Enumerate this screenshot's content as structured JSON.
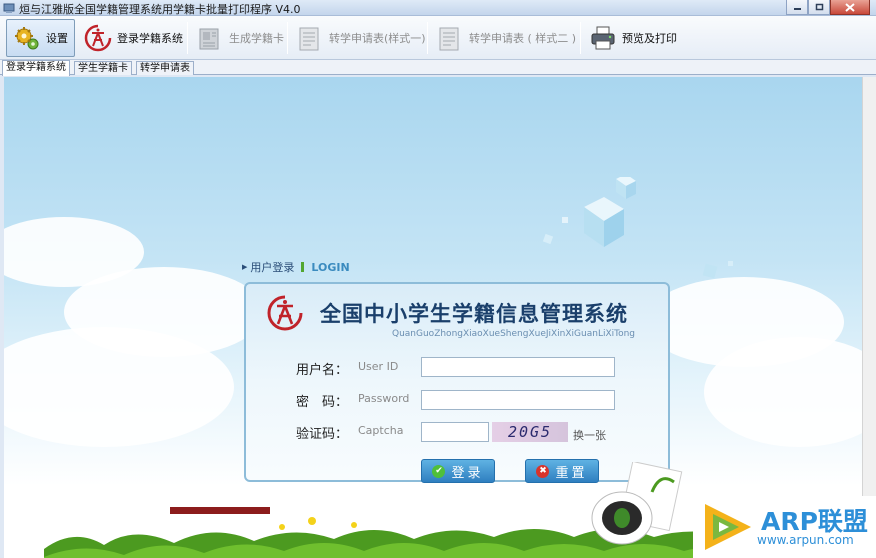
{
  "window": {
    "title": "烜与江雅版全国学籍管理系统用学籍卡批量打印程序 V4.0"
  },
  "toolbar": {
    "items": [
      {
        "label": "设置",
        "icon": "gear-icon",
        "state": "active"
      },
      {
        "label": "登录学籍系统",
        "icon": "system-logo-icon",
        "state": "enabled"
      },
      {
        "label": "生成学籍卡",
        "icon": "card-icon",
        "state": "disabled"
      },
      {
        "label": "转学申请表(样式一)",
        "icon": "form-icon",
        "state": "disabled"
      },
      {
        "label": "转学申请表 ( 样式二 )",
        "icon": "form-icon",
        "state": "disabled"
      },
      {
        "label": "预览及打印",
        "icon": "printer-icon",
        "state": "enabled"
      }
    ]
  },
  "tabs": [
    {
      "label": "登录学籍系统",
      "active": true
    },
    {
      "label": "学生学籍卡",
      "active": false
    },
    {
      "label": "转学申请表",
      "active": false
    }
  ],
  "login": {
    "header_cn": "用户登录",
    "header_en": "LOGIN",
    "system_title": "全国中小学生学籍信息管理系统",
    "system_pinyin": "QuanGuoZhongXiaoXueShengXueJiXinXiGuanLiXiTong",
    "username_label": "用户名：",
    "username_hint": "User ID",
    "username_value": "",
    "password_label": "密　码：",
    "password_hint": "Password",
    "password_value": "",
    "captcha_label": "验证码：",
    "captcha_hint": "Captcha",
    "captcha_value": "",
    "captcha_image_text": "20G5",
    "refresh_label": "换一张",
    "login_button": "登录",
    "reset_button": "重置"
  },
  "watermark": {
    "title": "ARP联盟",
    "url": "www.arpun.com"
  },
  "colors": {
    "brand_red": "#c0232a",
    "title_blue": "#1a3f6b",
    "button_blue": "#2f7fc0",
    "login_green": "#52a630",
    "watermark_blue": "#2d8fd8"
  }
}
